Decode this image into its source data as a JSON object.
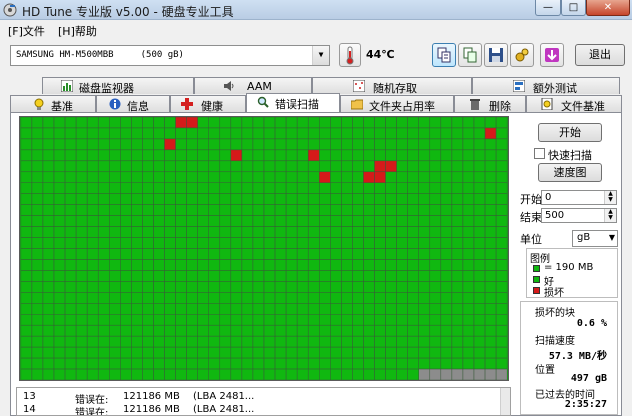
{
  "window": {
    "title": "HD Tune 专业版 v5.00 - 硬盘专业工具",
    "controls": {
      "minimize": "—",
      "maximize": "□",
      "close": "✕"
    }
  },
  "menu": {
    "file": "[F]文件",
    "help": "[H]帮助"
  },
  "toolbar": {
    "drive": "SAMSUNG HM-M500MBB     (500 gB)",
    "temperature": "44℃",
    "exit_label": "退出",
    "icons": [
      "copy-info-icon",
      "copy-text-icon",
      "save-icon",
      "options-icon",
      "download-icon"
    ]
  },
  "tabs": {
    "row1": [
      "磁盘监视器",
      "AAM",
      "随机存取",
      "额外测试"
    ],
    "row2": [
      "基准",
      "信息",
      "健康",
      "错误扫描",
      "文件夹占用率",
      "删除",
      "文件基准"
    ],
    "active": "错误扫描"
  },
  "scan": {
    "start_label": "开始",
    "quick_scan_label": "快速扫描",
    "quick_scan_checked": false,
    "map_label": "速度图",
    "start_field_label": "开始",
    "start_value": "0",
    "end_field_label": "结束",
    "end_value": "500",
    "unit_label": "单位",
    "unit_value": "gB",
    "legend_title": "图例",
    "legend_block": "= 190 MB",
    "legend_good": "好",
    "legend_bad": "损坏",
    "damaged_label": "损坏的块",
    "damaged_value": "0.6 %",
    "speed_label": "扫描速度",
    "speed_value": "57.3 MB/秒",
    "position_label": "位置",
    "position_value": "497 gB",
    "elapsed_label": "已过去的时间",
    "elapsed_value": "2:35:27"
  },
  "grid": {
    "cols": 44,
    "rows": 24,
    "colors": {
      "good": "#10b810",
      "bad": "#d51a1a",
      "pending": "#8c8c8c",
      "line": "#3a5a3a"
    },
    "bad_cells": [
      [
        0,
        14
      ],
      [
        0,
        15
      ],
      [
        1,
        42
      ],
      [
        2,
        13
      ],
      [
        3,
        19
      ],
      [
        3,
        26
      ],
      [
        4,
        32
      ],
      [
        4,
        33
      ],
      [
        5,
        27
      ],
      [
        5,
        31
      ],
      [
        5,
        32
      ]
    ],
    "pending_from_row": 23,
    "pending_from_col": 36
  },
  "log": [
    {
      "num": "13",
      "text": "错误在:",
      "mb": "121186 MB",
      "lba": "(LBA 2481..."
    },
    {
      "num": "14",
      "text": "错误在:",
      "mb": "121186 MB",
      "lba": "(LBA 2481..."
    }
  ]
}
